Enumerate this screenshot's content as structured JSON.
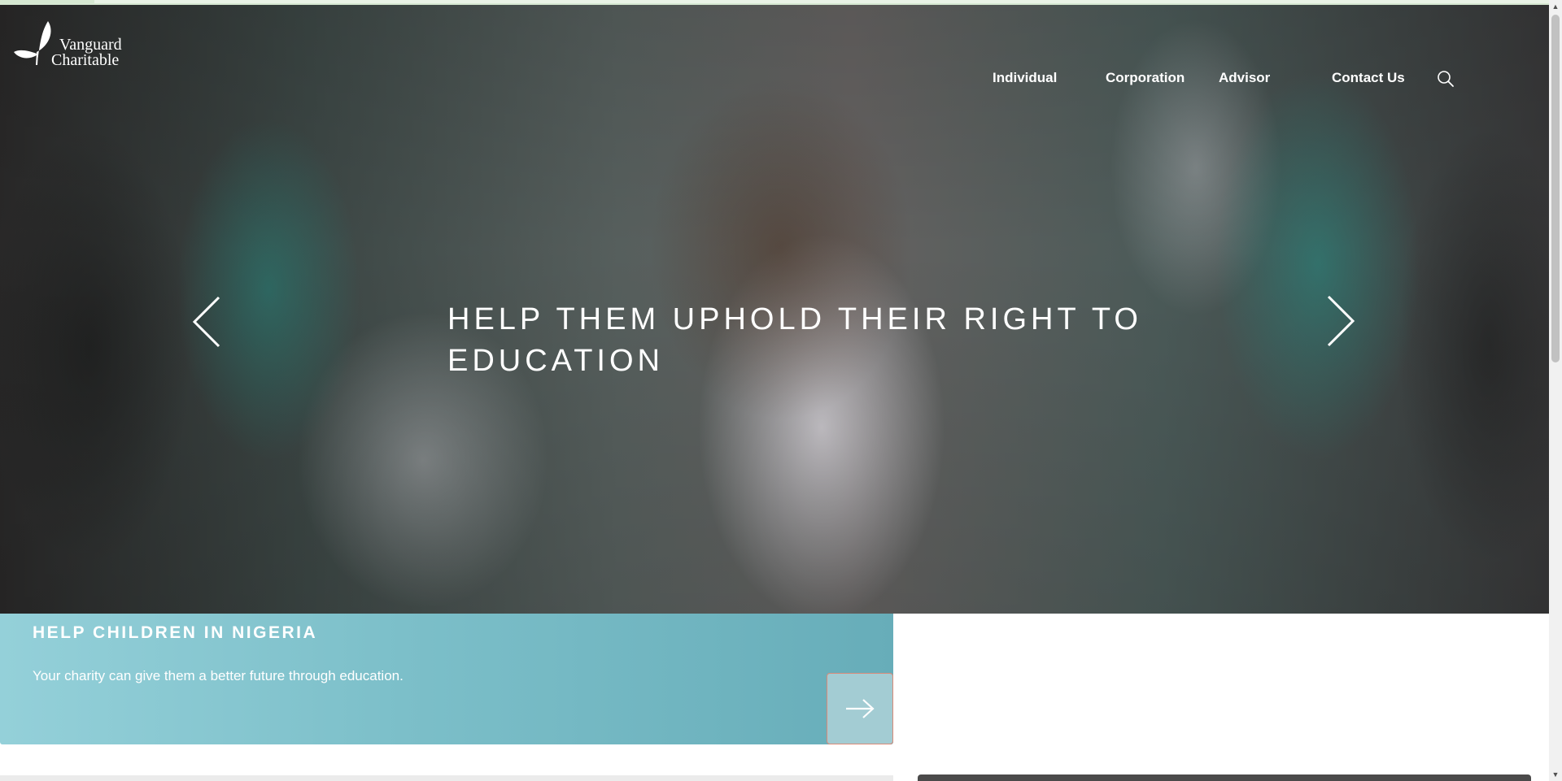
{
  "logo": {
    "line1": "Vanguard",
    "line2": "Charitable"
  },
  "nav": {
    "items": [
      {
        "label": "Individual"
      },
      {
        "label": "Corporation"
      },
      {
        "label": "Advisor"
      },
      {
        "label": "Contact Us"
      }
    ],
    "search_icon": "search-icon"
  },
  "hero": {
    "title": "HELP THEM UPHOLD THEIR RIGHT TO EDUCATION",
    "prev_icon": "chevron-left-icon",
    "next_icon": "chevron-right-icon"
  },
  "promo": {
    "heading": "HELP CHILDREN IN NIGERIA",
    "text": "Your charity can give them a better future through education.",
    "button_icon": "arrow-right-icon"
  },
  "colors": {
    "promo_bg": "#7cbfc9",
    "promo_button": "#a3ccd3",
    "promo_button_border": "#d98a78",
    "top_strip": "#d6e8d2"
  }
}
